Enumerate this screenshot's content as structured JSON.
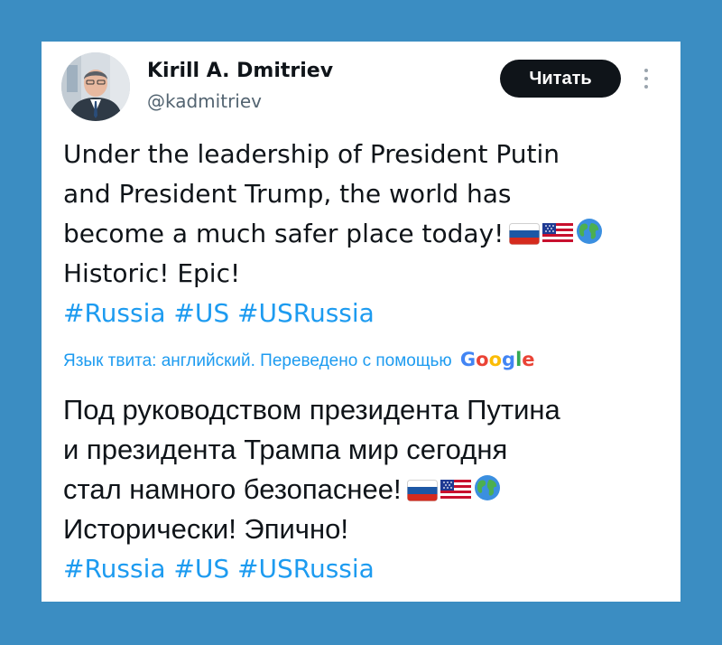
{
  "colors": {
    "background": "#3b8dc2",
    "card": "#ffffff",
    "text": "#0f1419",
    "secondary_text": "#536471",
    "link": "#1d9bf0",
    "button": "#0f1419"
  },
  "author": {
    "name": "Kirill A. Dmitriev",
    "handle": "@kadmitriev",
    "avatar_icon": "profile-photo"
  },
  "follow_button": {
    "label": "Читать"
  },
  "more_menu": {
    "icon": "vertical-ellipsis-icon"
  },
  "tweet": {
    "lines": [
      "Under the leadership of President Putin",
      "and President Trump, the world has",
      "become a much safer place today!",
      "Historic! Epic!"
    ],
    "emojis": [
      "russia-flag-icon",
      "usa-flag-icon",
      "globe-icon"
    ],
    "hashtags": "#Russia #US #USRussia"
  },
  "translation": {
    "note": "Язык твита: английский. Переведено с помощью",
    "provider": [
      "G",
      "o",
      "o",
      "g",
      "l",
      "e"
    ],
    "provider_colors": [
      "#4285f4",
      "#ea4335",
      "#fbbc05",
      "#4285f4",
      "#34a853",
      "#ea4335"
    ],
    "lines": [
      "Под руководством президента Путина",
      "и президента Трампа мир сегодня",
      "стал намного безопаснее!",
      "Исторически! Эпично!"
    ],
    "hashtags": "#Russia #US #USRussia"
  }
}
